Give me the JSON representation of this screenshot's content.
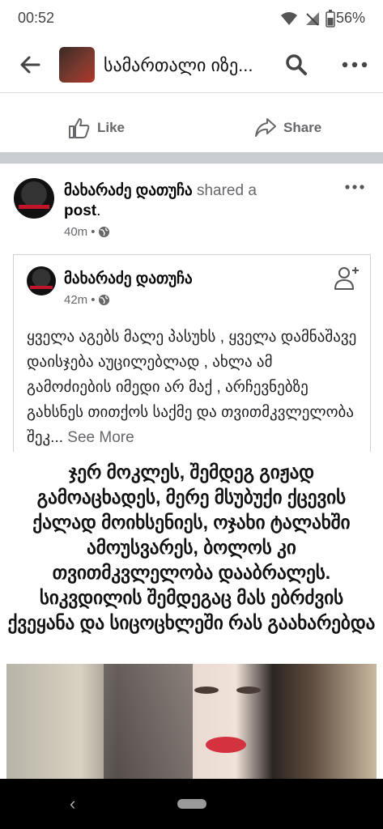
{
  "status_bar": {
    "time": "00:52",
    "battery": "56%"
  },
  "header": {
    "page_title": "სამართალი იზე..."
  },
  "actions": {
    "like_label": "Like",
    "share_label": "Share"
  },
  "post": {
    "author": "მახარაძე დათუჩა",
    "shared_text": "shared a",
    "post_word": "post",
    "post_period": ".",
    "time": "40m",
    "separator": "•"
  },
  "shared_post": {
    "author": "მახარაძე დათუჩა",
    "time": "42m",
    "separator": "•",
    "body": "ყველა აგებს მალე პასუხს , ყველა დამნაშავე დაისჯება აუცილებლად , ახლა ამ გამოძიების იმედი არ მაქ , არჩევნებზე გახსნეს თითქოს საქმე და თვითმკვლელობა შეკ...",
    "see_more": "See More"
  },
  "image_caption": "ჯერ მოკლეს, შემდეგ გიჟად გამოაცხადეს, მერე მსუბუქი ქცევის ქალად მოიხსენიეს, ოჯახი ტალახში ამოუსვარეს, ბოლოს კი თვითმკვლელობა დააბრალეს. სიკვდილის შემდეგაც მას ებრძვის ქვეყანა და სიცოცხლეში რას გაახარებდა"
}
